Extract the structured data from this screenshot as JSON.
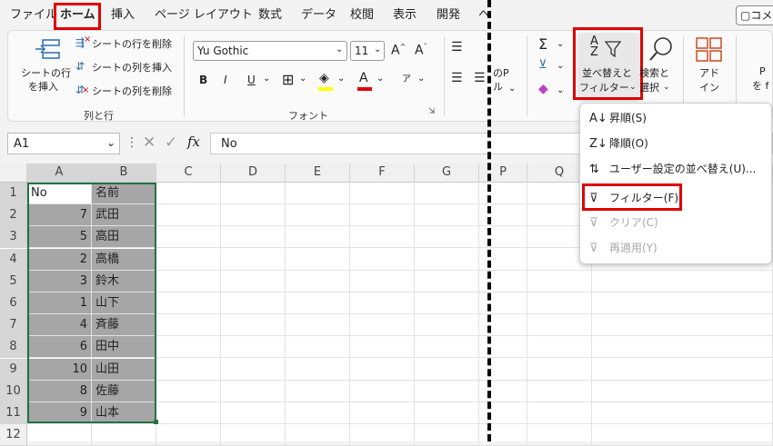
{
  "menu": {
    "items": [
      "ファイル",
      "ホーム",
      "挿入",
      "ページ レイアウト",
      "数式",
      "データ",
      "校閲",
      "表示",
      "開発",
      "ヘ"
    ],
    "comment_button": "コメ"
  },
  "ribbon": {
    "cells": {
      "insert_label_1": "シートの行",
      "insert_label_2": "を挿入",
      "delete_row": "シートの行を削除",
      "insert_col": "シートの列を挿入",
      "delete_col": "シートの列を削除",
      "group": "列と行"
    },
    "font": {
      "family": "Yu Gothic",
      "size": "11",
      "grow": "A",
      "shrink": "A",
      "bold": "B",
      "italic": "I",
      "underline": "U",
      "phonetic": "ア",
      "group": "フォント"
    },
    "editing": {
      "sort_filter_1": "並べ替えと",
      "sort_filter_2": "フィルター",
      "find_1": "検索と",
      "find_2": "選択",
      "addin_1": "アド",
      "addin_2": "イン",
      "partial_1": "のP",
      "partial_2": "ル",
      "p_label": "P",
      "p_label2": "を f"
    }
  },
  "formula_bar": {
    "name_box": "A1",
    "fx": "fx",
    "value": "No"
  },
  "grid": {
    "columns": [
      "A",
      "B",
      "C",
      "D",
      "E",
      "F",
      "G",
      "P",
      "Q"
    ],
    "rows": [
      "1",
      "2",
      "3",
      "4",
      "5",
      "6",
      "7",
      "8",
      "9",
      "10",
      "11",
      "12"
    ],
    "header": {
      "a": "No",
      "b": "名前"
    },
    "data": [
      {
        "no": "7",
        "name": "武田"
      },
      {
        "no": "5",
        "name": "高田"
      },
      {
        "no": "2",
        "name": "高橋"
      },
      {
        "no": "3",
        "name": "鈴木"
      },
      {
        "no": "1",
        "name": "山下"
      },
      {
        "no": "4",
        "name": "斉藤"
      },
      {
        "no": "6",
        "name": "田中"
      },
      {
        "no": "10",
        "name": "山田"
      },
      {
        "no": "8",
        "name": "佐藤"
      },
      {
        "no": "9",
        "name": "山本"
      }
    ]
  },
  "dropdown": {
    "items": [
      {
        "label": "昇順(S)",
        "icon": "sort-ascending-icon",
        "disabled": false
      },
      {
        "label": "降順(O)",
        "icon": "sort-descending-icon",
        "disabled": false
      },
      {
        "label": "ユーザー設定の並べ替え(U)...",
        "icon": "custom-sort-icon",
        "disabled": false
      },
      {
        "label": "フィルター(F)",
        "icon": "filter-icon",
        "disabled": false
      },
      {
        "label": "クリア(C)",
        "icon": "clear-filter-icon",
        "disabled": true
      },
      {
        "label": "再適用(Y)",
        "icon": "reapply-icon",
        "disabled": true
      }
    ]
  },
  "colors": {
    "highlight": "#e00000",
    "selection": "#a6a6a6",
    "font_color_bar": "#e00000",
    "fill_color_bar": "#ffff00"
  }
}
